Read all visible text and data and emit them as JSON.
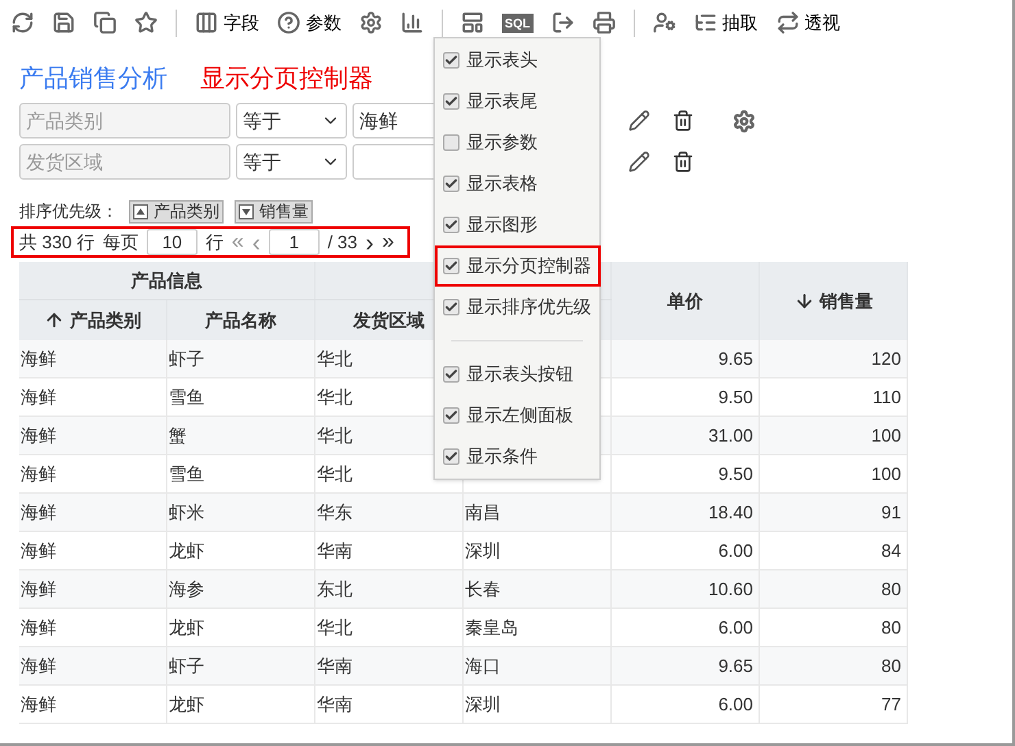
{
  "toolbar": [
    {
      "label": "字段"
    },
    {
      "label": "参数"
    },
    {
      "label": "SQL"
    },
    {
      "label": "抽取"
    },
    {
      "label": "透视"
    }
  ],
  "title": "产品销售分析",
  "annotation": "显示分页控制器",
  "conditions": [
    {
      "field": "产品类别",
      "operator": "等于",
      "value": "海鲜",
      "settings": true
    },
    {
      "field": "发货区域",
      "operator": "等于",
      "settings": false
    }
  ],
  "sort": {
    "label": "排序优先级：",
    "items": [
      {
        "label": "产品类别",
        "ascending": true
      },
      {
        "label": "销售量",
        "ascending": false
      }
    ]
  },
  "pager": {
    "highlighted": true,
    "total": "共 330 行",
    "per_page": "每页",
    "page_size": "10",
    "rows": "行",
    "first": "«",
    "prev": "‹",
    "page": "1",
    "of": "/ 33",
    "next": "›",
    "last": "»"
  },
  "table": {
    "group_header": "产品信息",
    "columns": [
      {
        "label": "产品类别",
        "sorted": true,
        "ascending": true
      },
      {
        "label": "产品名称",
        "sorted": false
      },
      {
        "label": "发货区域",
        "sorted": false
      },
      null,
      {
        "label": "单价",
        "sorted": false
      },
      {
        "label": "销售量",
        "sorted": true,
        "ascending": false
      }
    ],
    "rows": [
      [
        "海鲜",
        "虾子",
        "华北",
        null,
        "9.65",
        "120"
      ],
      [
        "海鲜",
        "雪鱼",
        "华北",
        null,
        "9.50",
        "110"
      ],
      [
        "海鲜",
        "蟹",
        "华北",
        null,
        "31.00",
        "100"
      ],
      [
        "海鲜",
        "雪鱼",
        "华北",
        null,
        "9.50",
        "100"
      ],
      [
        "海鲜",
        "虾米",
        "华东",
        "南昌",
        "18.40",
        "91"
      ],
      [
        "海鲜",
        "龙虾",
        "华南",
        "深圳",
        "6.00",
        "84"
      ],
      [
        "海鲜",
        "海参",
        "东北",
        "长春",
        "10.60",
        "80"
      ],
      [
        "海鲜",
        "龙虾",
        "华北",
        "秦皇岛",
        "6.00",
        "80"
      ],
      [
        "海鲜",
        "虾子",
        "华南",
        "海口",
        "9.65",
        "80"
      ],
      [
        "海鲜",
        "龙虾",
        "华南",
        "深圳",
        "6.00",
        "77"
      ]
    ]
  },
  "menu": {
    "items": [
      {
        "label": "显示表头",
        "checked": true,
        "highlighted": false
      },
      {
        "label": "显示表尾",
        "checked": true,
        "highlighted": false
      },
      {
        "label": "显示参数",
        "checked": false,
        "highlighted": false
      },
      {
        "label": "显示表格",
        "checked": true,
        "highlighted": false
      },
      {
        "label": "显示图形",
        "checked": true,
        "highlighted": false
      },
      {
        "label": "显示分页控制器",
        "checked": true,
        "highlighted": true
      },
      {
        "label": "显示排序优先级",
        "checked": true,
        "highlighted": false
      },
      {
        "label": "显示表头按钮",
        "checked": true,
        "highlighted": false,
        "separator_before": true
      },
      {
        "label": "显示左侧面板",
        "checked": true,
        "highlighted": false
      },
      {
        "label": "显示条件",
        "checked": true,
        "highlighted": false
      }
    ]
  }
}
